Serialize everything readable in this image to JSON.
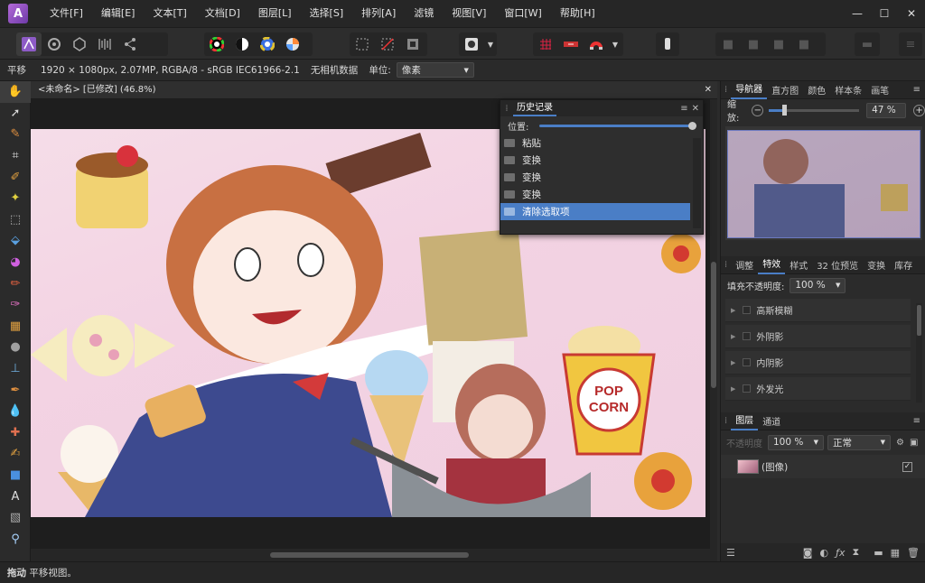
{
  "menubar": {
    "logo": "A",
    "items": [
      "文件[F]",
      "编辑[E]",
      "文本[T]",
      "文档[D]",
      "图层[L]",
      "选择[S]",
      "排列[A]",
      "滤镜",
      "视图[V]",
      "窗口[W]",
      "帮助[H]"
    ]
  },
  "window_controls": {
    "minimize": "—",
    "maximize": "☐",
    "close": "✕"
  },
  "context_bar": {
    "tool_name": "平移",
    "doc_info": "1920 × 1080px, 2.07MP, RGBA/8 - sRGB IEC61966-2.1",
    "camera": "无相机数据",
    "unit_label": "单位:",
    "unit_value": "像素"
  },
  "document_tab": {
    "title": "<未命名> [已修改] (46.8%)",
    "close": "✕"
  },
  "history_panel": {
    "title": "历史记录",
    "position_label": "位置:",
    "items": [
      "粘贴",
      "变换",
      "变换",
      "变换",
      "清除选取项"
    ],
    "selected_index": 4
  },
  "image_text": {
    "popcorn_line1": "POP",
    "popcorn_line2": "CORN"
  },
  "navigator_panel": {
    "tabs": [
      "导航器",
      "直方图",
      "颜色",
      "样本条",
      "画笔"
    ],
    "active_tab": "导航器",
    "zoom_label": "缩放:",
    "zoom_value": "47 %",
    "zoom_fraction": 0.47
  },
  "effects_panel": {
    "tabs": [
      "调整",
      "特效",
      "样式",
      "32 位预览",
      "变换",
      "库存"
    ],
    "active_tab": "特效",
    "fill_opacity_label": "填充不透明度:",
    "fill_opacity_value": "100 %",
    "effects": [
      "高斯模糊",
      "外阴影",
      "内阴影",
      "外发光"
    ]
  },
  "layers_panel": {
    "tabs": [
      "图层",
      "通道"
    ],
    "active_tab": "图层",
    "opacity_label": "不透明度",
    "opacity_value": "100 %",
    "blend_mode": "正常",
    "layer_name": "(图像)"
  },
  "status_bar": {
    "action": "拖动",
    "hint": "平移视图。"
  },
  "colors": {
    "accent": "#4a7ec6",
    "background": "#2b2b2b",
    "canvas_bg": "#1e1e1e"
  }
}
